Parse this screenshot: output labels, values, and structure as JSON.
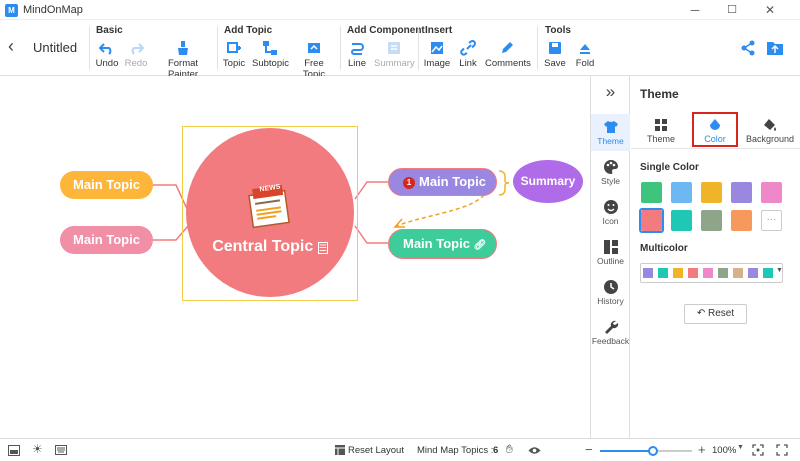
{
  "app": {
    "title": "MindOnMap",
    "document_title": "Untitled"
  },
  "window": {
    "minimize": "─",
    "maximize": "☐",
    "close": "✕"
  },
  "toolbar": {
    "groups": {
      "basic": "Basic",
      "add_topic": "Add Topic",
      "add_component": "Add Component",
      "insert": "Insert",
      "tools": "Tools"
    },
    "buttons": {
      "undo": "Undo",
      "redo": "Redo",
      "format_painter": "Format Painter",
      "topic": "Topic",
      "subtopic": "Subtopic",
      "free_topic": "Free Topic",
      "line": "Line",
      "summary": "Summary",
      "image": "Image",
      "link": "Link",
      "comments": "Comments",
      "save": "Save",
      "fold": "Fold"
    }
  },
  "canvas": {
    "central_topic": "Central Topic",
    "news_label": "NEWS",
    "left_topic_1": "Main Topic",
    "left_topic_2": "Main Topic",
    "right_topic_1": "Main Topic",
    "right_topic_1_badge": "1",
    "right_topic_2": "Main Topic",
    "summary": "Summary"
  },
  "sidebar": {
    "collapse": "»",
    "items": [
      {
        "label": "Theme",
        "icon": "shirt-icon"
      },
      {
        "label": "Style",
        "icon": "palette-icon"
      },
      {
        "label": "Icon",
        "icon": "smiley-icon"
      },
      {
        "label": "Outline",
        "icon": "outline-icon"
      },
      {
        "label": "History",
        "icon": "clock-icon"
      },
      {
        "label": "Feedback",
        "icon": "wrench-icon"
      }
    ]
  },
  "panel": {
    "title": "Theme",
    "tabs": [
      {
        "label": "Theme"
      },
      {
        "label": "Color"
      },
      {
        "label": "Background"
      }
    ],
    "single_color_title": "Single Color",
    "single_colors": [
      "#3ec47d",
      "#6db8f2",
      "#f0b429",
      "#9a87e0",
      "#ef88c9",
      "#f27b7f",
      "#1fc8b4",
      "#8fa58a",
      "#f59a5c"
    ],
    "more_label": "···",
    "multicolor_title": "Multicolor",
    "multicolors": [
      "#9a87e0",
      "#1fc8b4",
      "#f0b429",
      "#f27b7f",
      "#ef88c9",
      "#8fa58a",
      "#d9b08c",
      "#9a87e0",
      "#1fc8b4"
    ],
    "reset_label": "Reset"
  },
  "statusbar": {
    "reset_layout": "Reset Layout",
    "topics_label": "Mind Map Topics :",
    "topics_count": "6",
    "zoom_minus": "−",
    "zoom_plus": "+",
    "zoom_value": "100%",
    "zoom_level": 0.6
  },
  "colors": {
    "accent": "#2d8cf0",
    "central": "#f27b7f",
    "left_1": "#fdb53a",
    "left_2": "#f08fa5",
    "right_1": "#9a87e0",
    "right_2": "#3ecd9a",
    "summary": "#b06be8",
    "highlight": "#d9251d"
  }
}
